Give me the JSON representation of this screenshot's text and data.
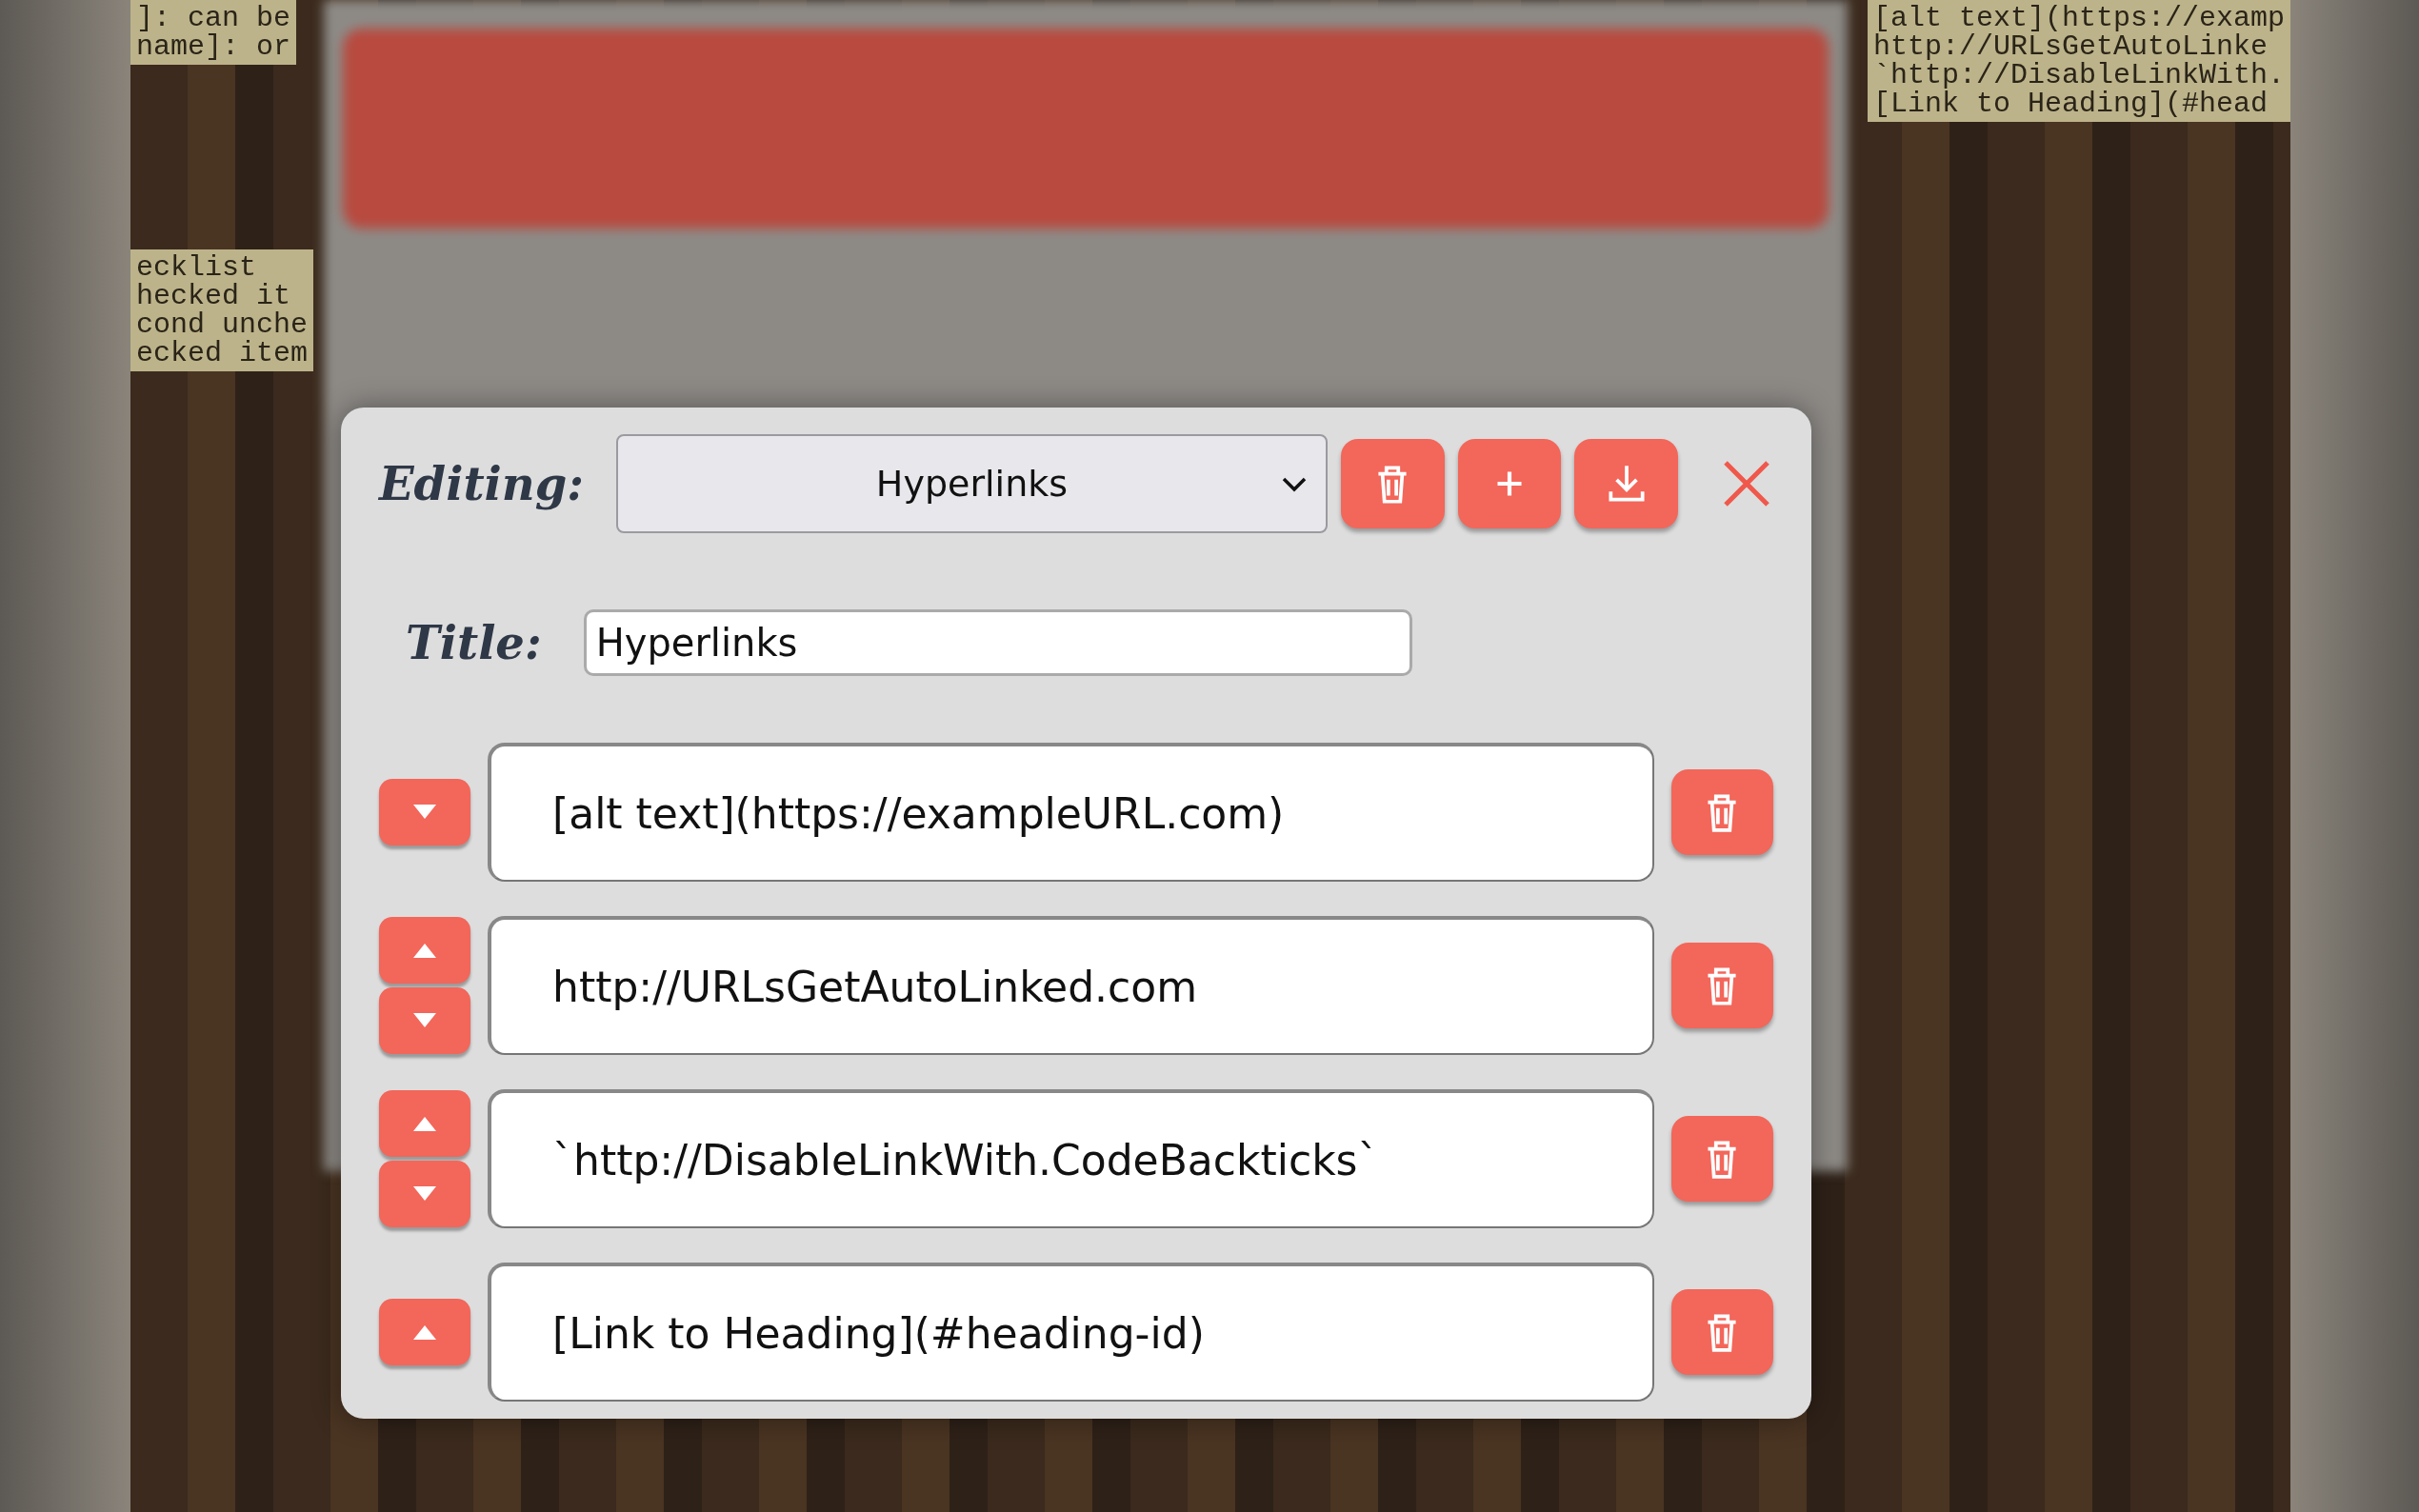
{
  "wallpaper_notes": [
    {
      "lines": [
        "]: can be",
        "name]: or"
      ]
    },
    {
      "lines": [
        "ecklist",
        "hecked it",
        "cond unche",
        "ecked item"
      ]
    },
    {
      "lines": [
        "[alt text](https://examp",
        "http://URLsGetAutoLinke",
        "`http://DisableLinkWith.",
        "[Link to Heading](#head"
      ]
    }
  ],
  "editor": {
    "editing_label": "Editing:",
    "selected_sheet": "Hyperlinks",
    "title_label": "Title:",
    "title_value": "Hyperlinks",
    "items": [
      {
        "text": "[alt text](https://exampleURL.com)",
        "can_move_up": false,
        "can_move_down": true
      },
      {
        "text": "http://URLsGetAutoLinked.com",
        "can_move_up": true,
        "can_move_down": true
      },
      {
        "text": "`http://DisableLinkWith.CodeBackticks`",
        "can_move_up": true,
        "can_move_down": true
      },
      {
        "text": "[Link to Heading](#heading-id)",
        "can_move_up": true,
        "can_move_down": false
      }
    ]
  }
}
